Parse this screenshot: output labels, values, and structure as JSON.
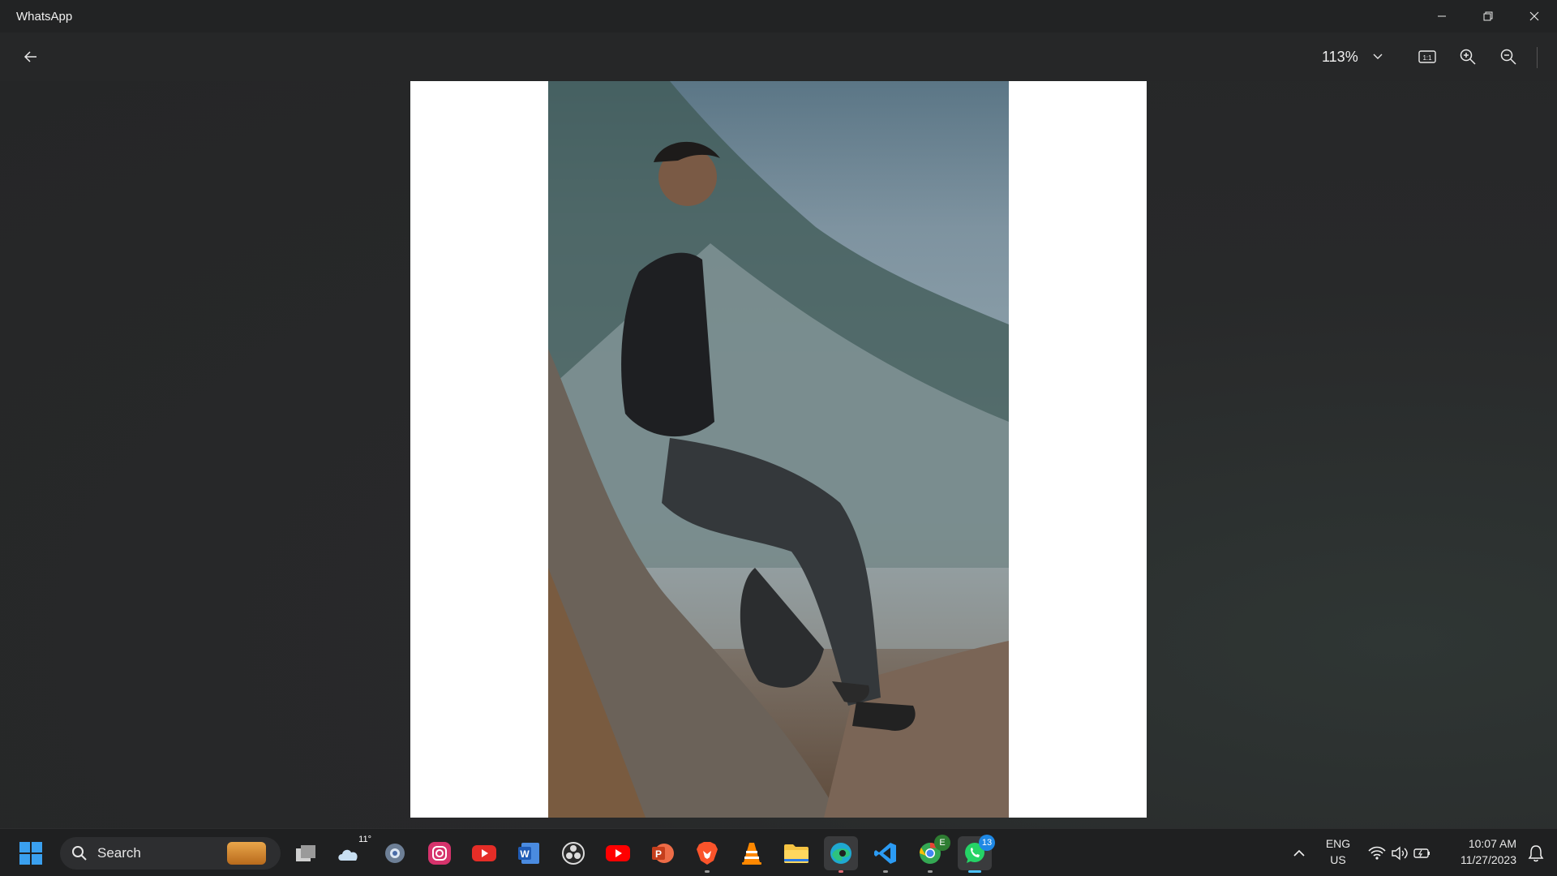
{
  "window": {
    "title": "WhatsApp",
    "controls": [
      "minimize-icon",
      "restore-icon",
      "close-icon"
    ]
  },
  "viewer_toolbar": {
    "back_icon": "arrow-left-icon",
    "zoom_value": "113%",
    "tools": [
      "actual-size-icon",
      "zoom-in-icon",
      "zoom-out-icon"
    ],
    "actual_size_label": "1:1"
  },
  "viewer": {
    "image_description": "photo",
    "background_color": "#ffffff"
  },
  "taskbar": {
    "search_placeholder": "Search",
    "weather_temp": "11°",
    "edge_badge": "E",
    "whatsapp_badge": "13",
    "pinned": [
      "file-explorer-icon",
      "weather-icon",
      "settings-icon",
      "instagram-icon",
      "youtube-icon",
      "word-icon",
      "obs-icon",
      "youtube-icon-2",
      "powerpoint-icon",
      "brave-icon",
      "vlc-icon",
      "folder-icon",
      "edge-icon",
      "vscode-icon",
      "chrome-icon",
      "whatsapp-icon"
    ],
    "tray": {
      "language_line1": "ENG",
      "language_line2": "US",
      "time": "10:07 AM",
      "date": "11/27/2023"
    }
  },
  "colors": {
    "titlebar": "#222324",
    "viewer_bg": "#262728",
    "taskbar": "#1f2021",
    "accent": "#4cc2ff"
  }
}
